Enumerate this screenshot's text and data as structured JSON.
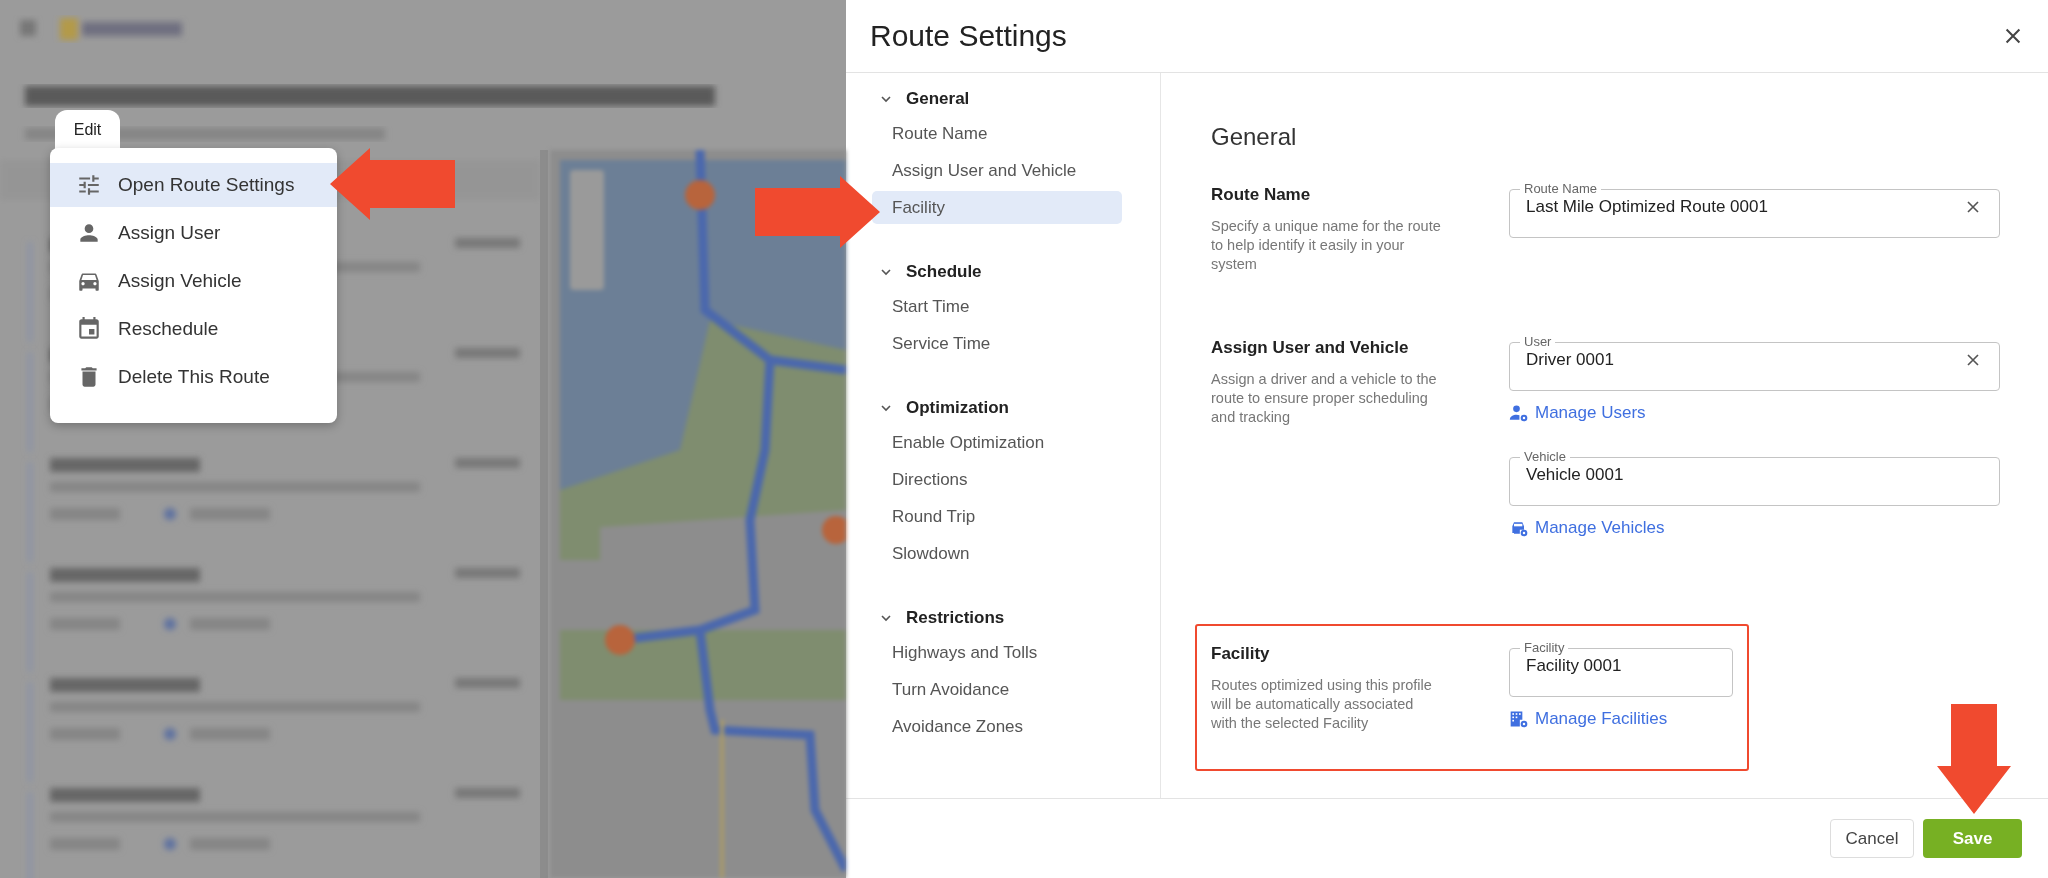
{
  "background": {
    "open_menu": "Edit",
    "menu": [
      {
        "label": "Open Route Settings",
        "selected": true
      },
      {
        "label": "Assign User",
        "selected": false
      },
      {
        "label": "Assign Vehicle",
        "selected": false
      },
      {
        "label": "Reschedule",
        "selected": false
      },
      {
        "label": "Delete This Route",
        "selected": false
      }
    ]
  },
  "dialog": {
    "title": "Route Settings",
    "nav": [
      {
        "heading": "General",
        "expanded": true,
        "items": [
          {
            "label": "Route Name",
            "selected": false
          },
          {
            "label": "Assign User and Vehicle",
            "selected": false
          },
          {
            "label": "Facility",
            "selected": true
          }
        ]
      },
      {
        "heading": "Schedule",
        "expanded": true,
        "items": [
          {
            "label": "Start Time",
            "selected": false
          },
          {
            "label": "Service Time",
            "selected": false
          }
        ]
      },
      {
        "heading": "Optimization",
        "expanded": true,
        "items": [
          {
            "label": "Enable Optimization",
            "selected": false
          },
          {
            "label": "Directions",
            "selected": false
          },
          {
            "label": "Round Trip",
            "selected": false
          },
          {
            "label": "Slowdown",
            "selected": false
          }
        ]
      },
      {
        "heading": "Restrictions",
        "expanded": true,
        "items": [
          {
            "label": "Highways and Tolls",
            "selected": false
          },
          {
            "label": "Turn Avoidance",
            "selected": false
          },
          {
            "label": "Avoidance Zones",
            "selected": false
          }
        ]
      }
    ],
    "content": {
      "heading": "General",
      "sections": [
        {
          "title": "Route Name",
          "description": "Specify a unique name for the route to help identify it easily in your system",
          "highlighted": false,
          "controls": [
            {
              "kind": "field",
              "label": "Route Name",
              "value": "Last Mile Optimized Route 0001",
              "clearable": true
            }
          ]
        },
        {
          "title": "Assign User and Vehicle",
          "description": "Assign a driver and a vehicle to the route to ensure proper scheduling and tracking",
          "highlighted": false,
          "controls": [
            {
              "kind": "field",
              "label": "User",
              "value": "Driver 0001",
              "clearable": true
            },
            {
              "kind": "link",
              "label": "Manage Users"
            },
            {
              "kind": "field",
              "label": "Vehicle",
              "value": "Vehicle 0001",
              "clearable": false
            },
            {
              "kind": "link",
              "label": "Manage Vehicles"
            }
          ]
        },
        {
          "title": "Facility",
          "description": "Routes optimized using this profile will be automatically associated with the selected Facility",
          "highlighted": true,
          "controls": [
            {
              "kind": "field",
              "label": "Facility",
              "value": "Facility 0001",
              "clearable": false
            },
            {
              "kind": "link",
              "label": "Manage Facilities"
            }
          ]
        }
      ]
    },
    "buttons": [
      {
        "label": "Cancel",
        "kind": "secondary"
      },
      {
        "label": "Save",
        "kind": "primary"
      }
    ]
  }
}
